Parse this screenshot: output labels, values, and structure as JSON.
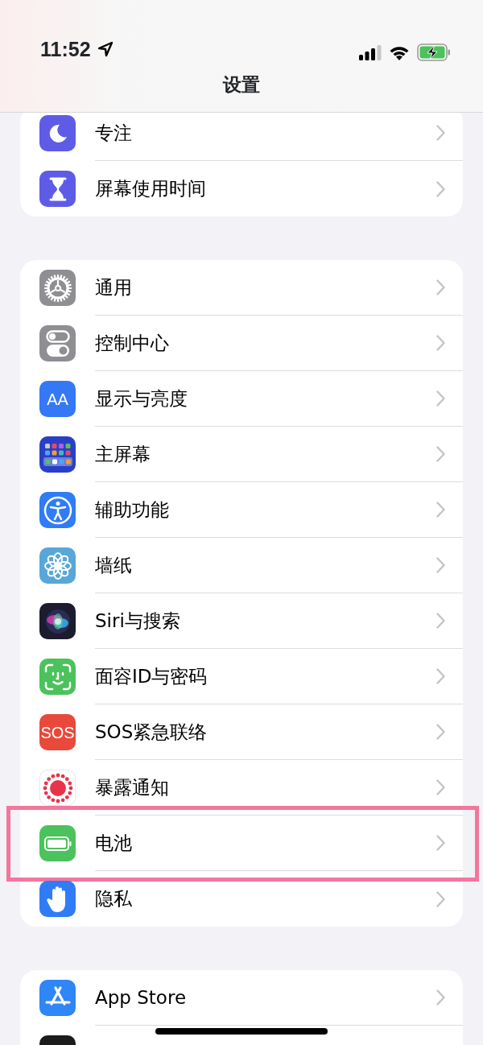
{
  "status_bar": {
    "time": "11:52"
  },
  "title": "设置",
  "groups": [
    {
      "items": [
        {
          "label": "专注",
          "kind": "moon",
          "color": "#5e5ce6",
          "highlighted": false
        },
        {
          "label": "屏幕使用时间",
          "kind": "hourglass",
          "color": "#5e5ce6",
          "highlighted": false
        }
      ]
    },
    {
      "items": [
        {
          "label": "通用",
          "kind": "gear",
          "color": "#8e8e93",
          "highlighted": false
        },
        {
          "label": "控制中心",
          "kind": "toggles",
          "color": "#8e8e93",
          "highlighted": false
        },
        {
          "label": "显示与亮度",
          "kind": "text",
          "icon_text": "AA",
          "color": "#3478f6",
          "highlighted": false
        },
        {
          "label": "主屏幕",
          "kind": "grid",
          "color": "#2a3fc7",
          "highlighted": false
        },
        {
          "label": "辅助功能",
          "kind": "accessibility",
          "color": "#2f7cf6",
          "highlighted": false
        },
        {
          "label": "墙纸",
          "kind": "flower",
          "color": "#58a7d8",
          "highlighted": false
        },
        {
          "label": "Siri与搜索",
          "kind": "siri",
          "color": "#1c1c2e",
          "highlighted": false
        },
        {
          "label": "面容ID与密码",
          "kind": "face",
          "color": "#4cc25c",
          "highlighted": false
        },
        {
          "label": "SOS紧急联络",
          "kind": "text",
          "icon_text": "SOS",
          "color": "#e8493a",
          "highlighted": false
        },
        {
          "label": "暴露通知",
          "kind": "exposure",
          "color": "#ffffff",
          "highlighted": false
        },
        {
          "label": "电池",
          "kind": "battery",
          "color": "#4cc25c",
          "highlighted": true
        },
        {
          "label": "隐私",
          "kind": "hand",
          "color": "#2f7cf6",
          "highlighted": false
        }
      ]
    },
    {
      "items": [
        {
          "label": "App Store",
          "kind": "appstore",
          "color": "#2f86f6",
          "highlighted": false
        },
        {
          "kind": "blank",
          "color": "#1c1c1e",
          "highlighted": false
        }
      ]
    }
  ]
}
